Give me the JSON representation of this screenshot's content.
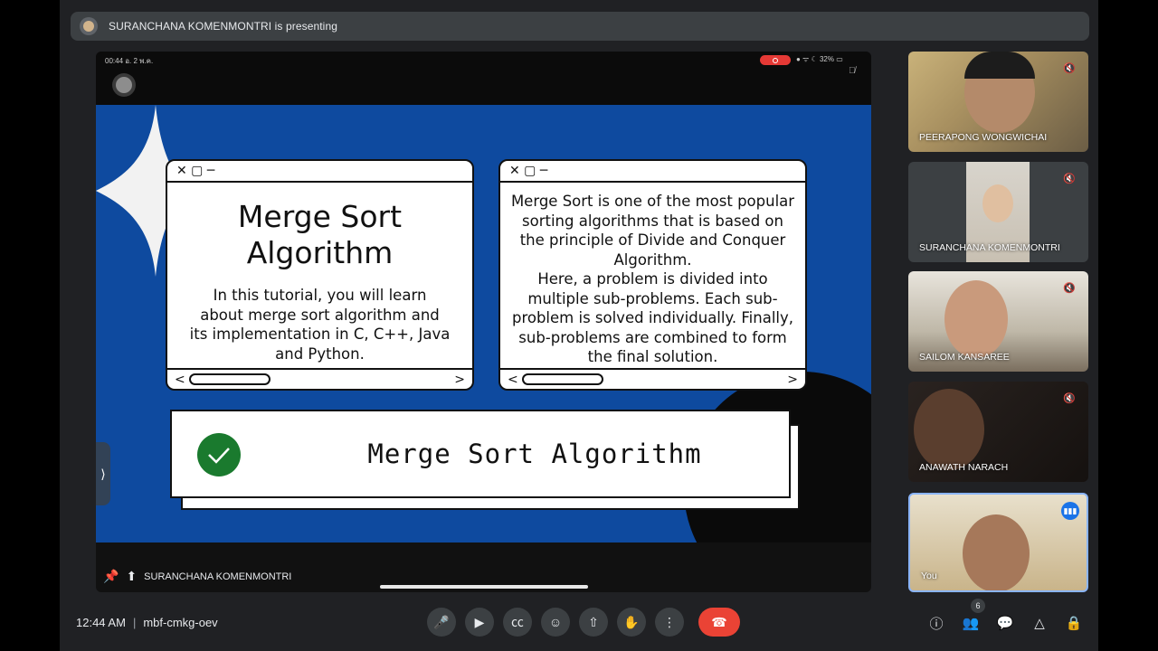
{
  "banner": {
    "presenting_text": "SURANCHANA KOMENMONTRI is presenting"
  },
  "phone_status": {
    "time": "00:44  อ. 2 พ.ค.",
    "battery": "32%"
  },
  "slide": {
    "window1": {
      "controls": "✕ ▢ ─",
      "title_line1": "Merge Sort",
      "title_line2": "Algorithm",
      "desc_line1": "In this tutorial, you will learn",
      "desc_line2": "about merge sort algorithm and",
      "desc_line3": "its implementation in C, C++, Java",
      "desc_line4": "and Python.",
      "scroll_left": "<",
      "scroll_right": ">"
    },
    "window2": {
      "controls": "✕ ▢ ─",
      "line1": "Merge Sort is one of the most popular",
      "line2": "sorting algorithms that is based on",
      "line3": "the principle of Divide and Conquer",
      "line4": "Algorithm.",
      "line5": "Here, a problem is divided into",
      "line6": "multiple sub-problems. Each sub-",
      "line7": "problem is solved individually. Finally,",
      "line8": "sub-problems are combined to form",
      "line9": "the final solution.",
      "scroll_left": "<",
      "scroll_right": ">"
    },
    "card": {
      "label": "Merge Sort Algorithm"
    }
  },
  "presenter_label": "SURANCHANA KOMENMONTRI",
  "participants": [
    {
      "name": "PEERAPONG WONGWICHAI"
    },
    {
      "name": "SURANCHANA KOMENMONTRI"
    },
    {
      "name": "SAILOM KANSAREE"
    },
    {
      "name": "ANAWATH NARACH"
    },
    {
      "name": "You"
    }
  ],
  "bottom": {
    "time": "12:44 AM",
    "meeting_code": "mbf-cmkg-oev",
    "participant_count": "6"
  },
  "colors": {
    "end_call": "#ea4335",
    "slide_bg": "#0e4a9f",
    "active_border": "#8ab4f8"
  }
}
